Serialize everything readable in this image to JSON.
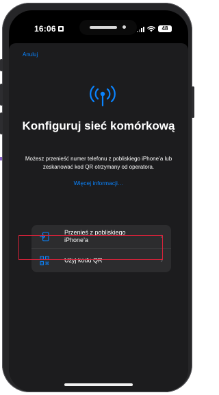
{
  "status_bar": {
    "time": "16:06",
    "battery": "48"
  },
  "sheet": {
    "cancel_label": "Anuluj",
    "title": "Konfiguruj sieć komórkową",
    "description": "Możesz przenieść numer telefonu z pobliskiego iPhone’a lub zeskanować kod QR otrzymany od operatora.",
    "more_info_link": "Więcej informacji…",
    "header_icon": "antenna-icon",
    "options": [
      {
        "label": "Przenieś z pobliskiego iPhone’a",
        "icon": "transfer-icon"
      },
      {
        "label": "Użyj kodu QR",
        "icon": "qr-code-icon"
      }
    ]
  },
  "colors": {
    "accent": "#0a84ff",
    "highlight_border": "#d9223a",
    "sheet_background": "#1c1c1e",
    "option_background": "#2c2c2e"
  }
}
